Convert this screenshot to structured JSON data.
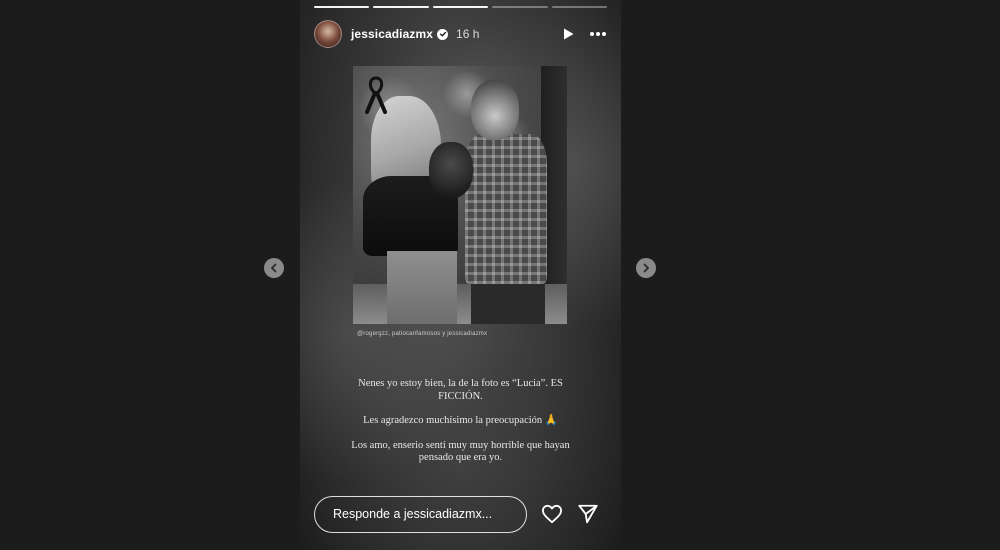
{
  "story": {
    "progress_segments": [
      true,
      true,
      true,
      false,
      false
    ],
    "username": "jessicadiazmx",
    "time_ago": "16 h",
    "photo_credit": "@rogergzz, patiocanfamosos y jessicadiazmx",
    "message_lines": [
      "Nenes yo estoy bien, la de la foto es “Lucia”. ES FICCIÓN.",
      "Les agradezco muchísimo la preocupación 🙏",
      "Los amo, enserio sentí muy muy horrible que hayan pensado que era yo."
    ],
    "reply_placeholder": "Responde a jessicadiazmx..."
  },
  "icons": {
    "verified": "verified-badge-icon",
    "play": "play-icon",
    "more": "more-icon",
    "heart": "heart-icon",
    "send": "send-icon",
    "prev": "chevron-left-icon",
    "next": "chevron-right-icon",
    "mourning": "black-ribbon-icon"
  },
  "colors": {
    "page_background": "#1c1c1c",
    "text": "#ffffff",
    "nav_button": "#8a8a8a"
  }
}
